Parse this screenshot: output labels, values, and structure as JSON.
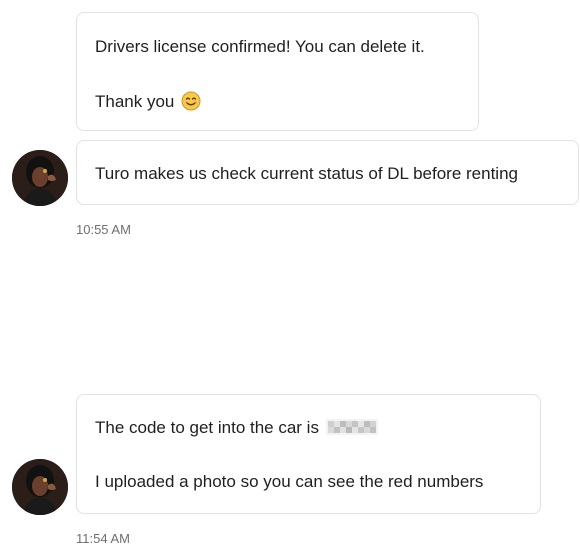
{
  "messages": [
    {
      "lines": [
        "Drivers license confirmed! You can delete it.",
        "Thank you"
      ],
      "trailing_icon": "smiling-face-emoji"
    },
    {
      "lines": [
        "Turo makes us check current status of DL before renting"
      ],
      "timestamp": "10:55 AM"
    },
    {
      "lines": [
        "The code to get into the car is",
        "I uploaded a photo so you can see the red numbers"
      ],
      "redacted_code_icon": "pixelated-redaction",
      "timestamp": "11:54 AM"
    }
  ],
  "colors": {
    "bubble_border": "#e2e2e2",
    "text": "#1f1f1f",
    "timestamp": "#6f6f6f",
    "emoji": "#f7c948"
  }
}
